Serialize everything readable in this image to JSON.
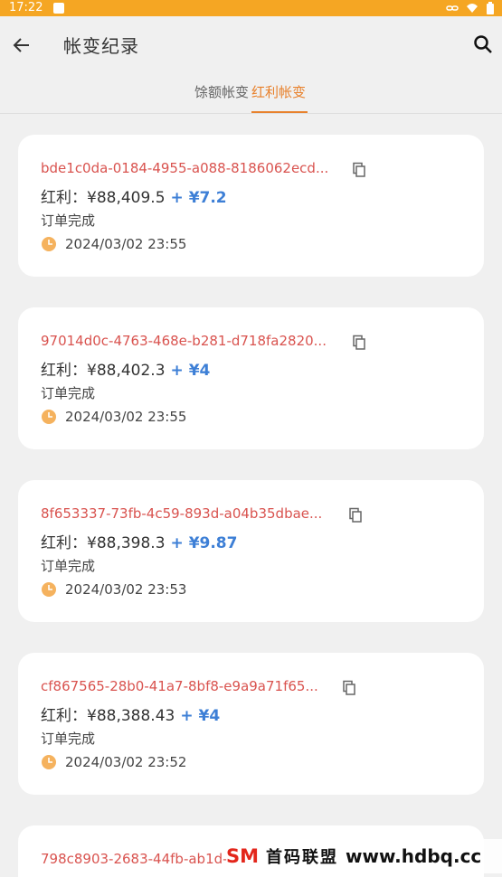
{
  "status_bar": {
    "time": "17:22"
  },
  "header": {
    "title": "帐变纪录"
  },
  "tabs": [
    {
      "label": "馀额帐变",
      "active": false
    },
    {
      "label": "红利帐变",
      "active": true
    }
  ],
  "records": [
    {
      "id": "bde1c0da-0184-4955-a088-8186062ecd...",
      "amount_label": "红利：",
      "amount": "¥88,409.5",
      "change": "+ ¥7.2",
      "status": "订单完成",
      "time": "2024/03/02 23:55"
    },
    {
      "id": "97014d0c-4763-468e-b281-d718fa2820...",
      "amount_label": "红利：",
      "amount": "¥88,402.3",
      "change": "+ ¥4",
      "status": "订单完成",
      "time": "2024/03/02 23:55"
    },
    {
      "id": "8f653337-73fb-4c59-893d-a04b35dbae...",
      "amount_label": "红利：",
      "amount": "¥88,398.3",
      "change": "+ ¥9.87",
      "status": "订单完成",
      "time": "2024/03/02 23:53"
    },
    {
      "id": "cf867565-28b0-41a7-8bf8-e9a9a71f65...",
      "amount_label": "红利：",
      "amount": "¥88,388.43",
      "change": "+ ¥4",
      "status": "订单完成",
      "time": "2024/03/02 23:52"
    },
    {
      "id": "798c8903-2683-44fb-ab1d-",
      "amount_label": "",
      "amount": "",
      "change": "",
      "status": "",
      "time": ""
    }
  ],
  "watermark": {
    "logo": "SM",
    "text": "首码联盟",
    "url": "www.hdbq.cc"
  },
  "colors": {
    "status_bar": "#f5a623",
    "accent": "#e8812c",
    "record_id": "#d9534f",
    "change": "#3d7fd6",
    "background": "#f0f0f0"
  },
  "icons": {
    "back": "arrow-left-icon",
    "search": "search-icon",
    "copy": "copy-icon",
    "clock": "clock-icon"
  }
}
